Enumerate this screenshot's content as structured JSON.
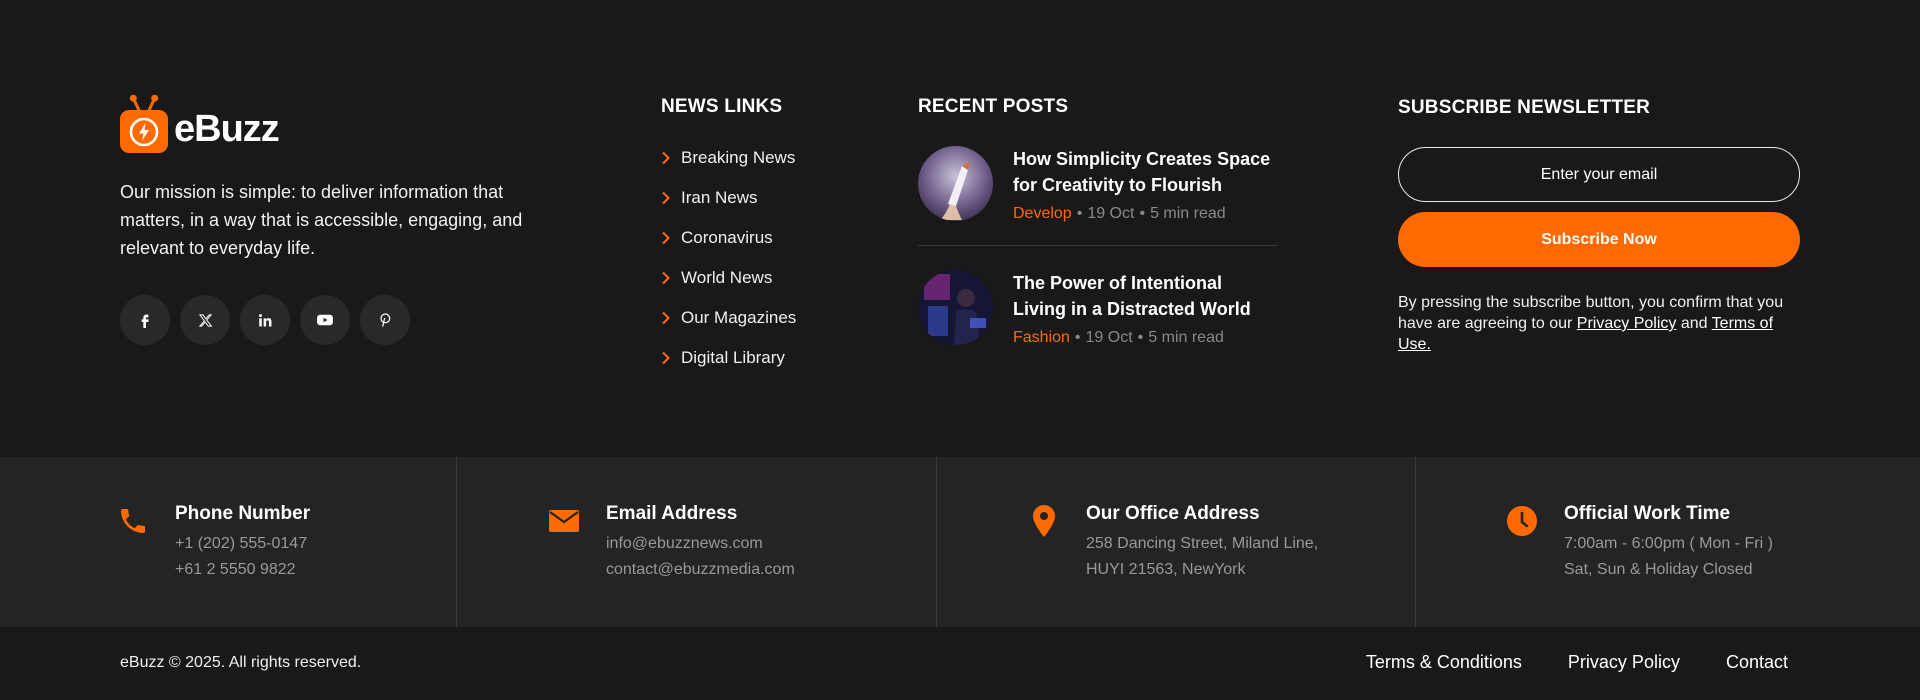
{
  "brand": {
    "name": "eBuzz",
    "mission": "Our mission is simple: to deliver information that matters, in a way that is accessible, engaging, and relevant to everyday life.",
    "accent_color": "#ff6a00"
  },
  "socials": [
    {
      "name": "facebook-icon"
    },
    {
      "name": "x-icon"
    },
    {
      "name": "linkedin-icon"
    },
    {
      "name": "youtube-icon"
    },
    {
      "name": "pinterest-icon"
    }
  ],
  "news_links": {
    "title": "NEWS LINKS",
    "items": [
      "Breaking News",
      "Iran News",
      "Coronavirus",
      "World News",
      "Our Magazines",
      "Digital Library"
    ]
  },
  "recent_posts": {
    "title": "RECENT POSTS",
    "items": [
      {
        "title": "How Simplicity Creates Space for Creativity to Flourish",
        "category": "Develop",
        "date": "19 Oct",
        "read_time": "5 min read"
      },
      {
        "title": "The Power of Intentional Living in a Distracted World",
        "category": "Fashion",
        "date": "19 Oct",
        "read_time": "5 min read"
      }
    ]
  },
  "newsletter": {
    "title": "SUBSCRIBE NEWSLETTER",
    "placeholder": "Enter your email",
    "button_label": "Subscribe Now",
    "note_before": "By pressing the subscribe button, you confirm that you have are agreeing to our ",
    "privacy_link": "Privacy Policy",
    "note_and": " and ",
    "terms_link": "Terms of Use."
  },
  "contacts": [
    {
      "icon": "phone-icon",
      "heading": "Phone Number",
      "line1": "+1 (202) 555-0147",
      "line2": "+61 2 5550 9822"
    },
    {
      "icon": "envelope-icon",
      "heading": "Email Address",
      "line1": "info@ebuzznews.com",
      "line2": "contact@ebuzzmedia.com"
    },
    {
      "icon": "map-pin-icon",
      "heading": "Our Office Address",
      "line1": "258 Dancing Street, Miland Line,",
      "line2": "HUYI 21563, NewYork"
    },
    {
      "icon": "clock-icon",
      "heading": "Official Work Time",
      "line1": "7:00am - 6:00pm ( Mon - Fri )",
      "line2": "Sat, Sun & Holiday Closed"
    }
  ],
  "footer": {
    "copyright": "eBuzz © 2025. All rights reserved.",
    "links": [
      "Terms & Conditions",
      "Privacy Policy",
      "Contact"
    ]
  }
}
